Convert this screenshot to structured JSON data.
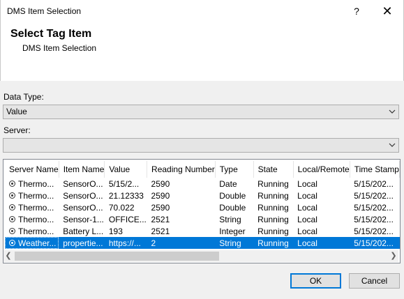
{
  "window": {
    "title": "DMS Item Selection",
    "help_glyph": "?",
    "close_glyph": "✕"
  },
  "header": {
    "title": "Select Tag Item",
    "subtitle": "DMS Item Selection"
  },
  "form": {
    "data_type_label": "Data Type:",
    "data_type_value": "Value",
    "server_label": "Server:",
    "server_value": ""
  },
  "table": {
    "columns": [
      "Server Name",
      "Item Name",
      "Value",
      "Reading Number",
      "Type",
      "State",
      "Local/Remote",
      "Time Stamp"
    ],
    "rows": [
      [
        "Thermo...",
        "SensorO...",
        "5/15/2...",
        "2590",
        "Date",
        "Running",
        "Local",
        "5/15/202..."
      ],
      [
        "Thermo...",
        "SensorO...",
        "21.12333",
        "2590",
        "Double",
        "Running",
        "Local",
        "5/15/202..."
      ],
      [
        "Thermo...",
        "SensorO...",
        "70.022",
        "2590",
        "Double",
        "Running",
        "Local",
        "5/15/202..."
      ],
      [
        "Thermo...",
        "Sensor-1...",
        "OFFICE...",
        "2521",
        "String",
        "Running",
        "Local",
        "5/15/202..."
      ],
      [
        "Thermo...",
        "Battery L...",
        "193",
        "2521",
        "Integer",
        "Running",
        "Local",
        "5/15/202..."
      ],
      [
        "Weather...",
        "propertie...",
        "https://...",
        "2",
        "String",
        "Running",
        "Local",
        "5/15/202..."
      ]
    ],
    "selected_row": 5
  },
  "buttons": {
    "ok": "OK",
    "cancel": "Cancel"
  },
  "icons": {
    "dropdown": "chevron-down-icon",
    "scroll_left": "chevron-left-icon",
    "scroll_right": "chevron-right-icon",
    "row_radio": "radio-icon"
  },
  "colors": {
    "selection": "#0078d7",
    "default_button_border": "#0078d7"
  }
}
